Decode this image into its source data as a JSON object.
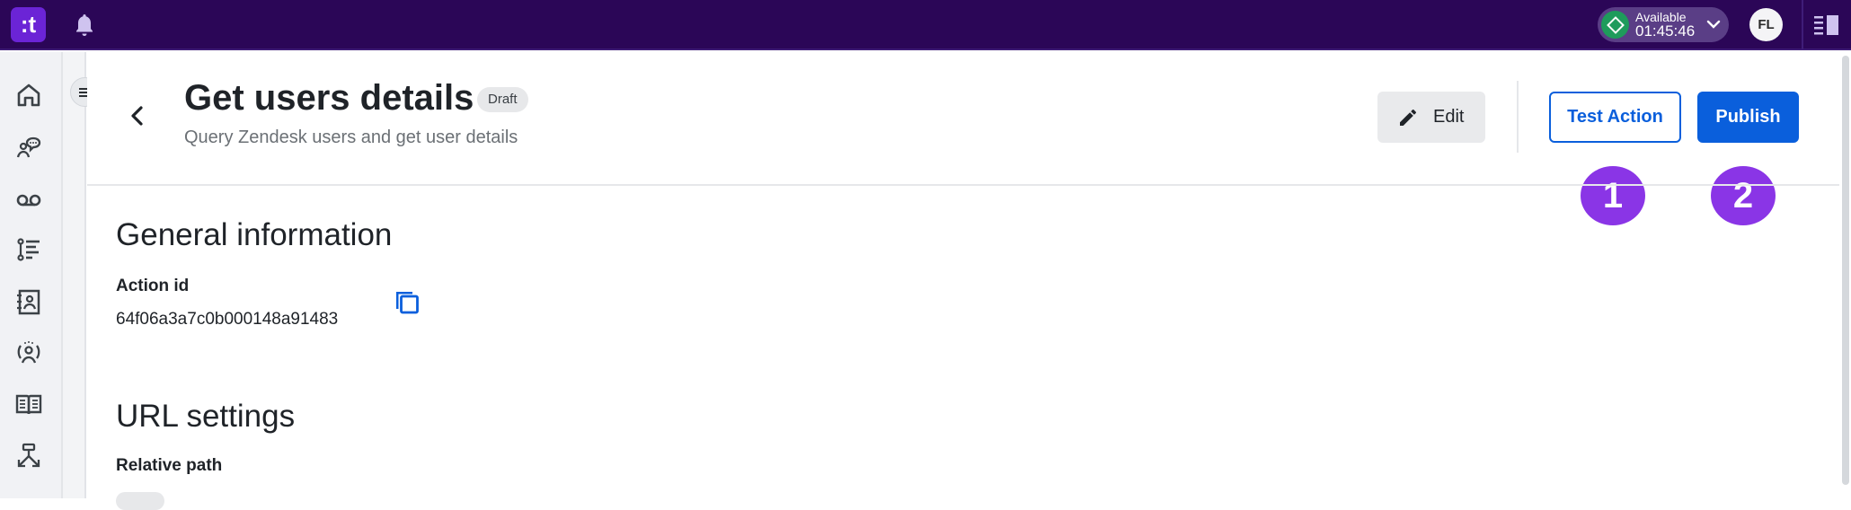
{
  "topbar": {
    "logo_text": ":t",
    "status": {
      "label": "Available",
      "timer": "01:45:46",
      "color": "#1e9b5b"
    },
    "avatar_initials": "FL"
  },
  "sidebar": {
    "items": [
      {
        "name": "home",
        "icon": "home-icon"
      },
      {
        "name": "conversations",
        "icon": "agent-chat-icon"
      },
      {
        "name": "voicemail",
        "icon": "voicemail-icon"
      },
      {
        "name": "workflows",
        "icon": "list-flow-icon"
      },
      {
        "name": "contacts",
        "icon": "contact-book-icon"
      },
      {
        "name": "supervision",
        "icon": "user-circle-icon"
      },
      {
        "name": "knowledge-base",
        "icon": "book-icon"
      },
      {
        "name": "routing",
        "icon": "routing-icon"
      }
    ]
  },
  "header": {
    "title": "Get users details",
    "badge": "Draft",
    "subtitle": "Query Zendesk users and get user details",
    "edit_label": "Edit",
    "test_label": "Test Action",
    "publish_label": "Publish",
    "accent": "#0a5fdc"
  },
  "markers": [
    "1",
    "2"
  ],
  "general": {
    "title": "General information",
    "action_id_label": "Action id",
    "action_id_value": "64f06a3a7c0b000148a91483"
  },
  "url": {
    "title": "URL settings",
    "relative_path_label": "Relative path"
  }
}
